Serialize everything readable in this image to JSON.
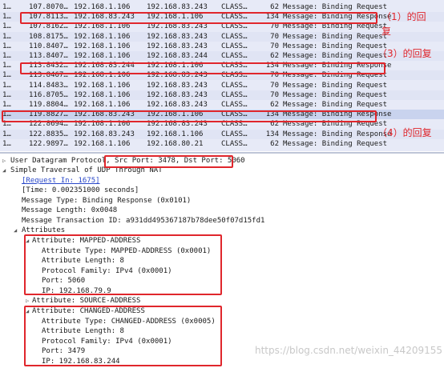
{
  "packets": [
    {
      "no": "1…",
      "time": "107.8070…",
      "src": "192.168.1.106",
      "dst": "192.168.83.243",
      "proto": "CLASS…",
      "len": "62",
      "info": "Message: Binding Request"
    },
    {
      "no": "1…",
      "time": "107.8113…",
      "src": "192.168.83.243",
      "dst": "192.168.1.106",
      "proto": "CLASS…",
      "len": "134",
      "info": "Message: Binding Response"
    },
    {
      "no": "1…",
      "time": "107.8162…",
      "src": "192.168.1.106",
      "dst": "192.168.83.243",
      "proto": "CLASS…",
      "len": "70",
      "info": "Message: Binding Request"
    },
    {
      "no": "1…",
      "time": "108.8175…",
      "src": "192.168.1.106",
      "dst": "192.168.83.243",
      "proto": "CLASS…",
      "len": "70",
      "info": "Message: Binding Request"
    },
    {
      "no": "1…",
      "time": "110.8407…",
      "src": "192.168.1.106",
      "dst": "192.168.83.243",
      "proto": "CLASS…",
      "len": "70",
      "info": "Message: Binding Request"
    },
    {
      "no": "1…",
      "time": "113.8407…",
      "src": "192.168.1.106",
      "dst": "192.168.83.244",
      "proto": "CLASS…",
      "len": "62",
      "info": "Message: Binding Request"
    },
    {
      "no": "1…",
      "time": "113.8432…",
      "src": "192.168.83.244",
      "dst": "192.168.1.106",
      "proto": "CLASS…",
      "len": "134",
      "info": "Message: Binding Response"
    },
    {
      "no": "1…",
      "time": "113.8467…",
      "src": "192.168.1.106",
      "dst": "192.168.83.243",
      "proto": "CLASS…",
      "len": "70",
      "info": "Message: Binding Request"
    },
    {
      "no": "1…",
      "time": "114.8483…",
      "src": "192.168.1.106",
      "dst": "192.168.83.243",
      "proto": "CLASS…",
      "len": "70",
      "info": "Message: Binding Request"
    },
    {
      "no": "1…",
      "time": "116.8705…",
      "src": "192.168.1.106",
      "dst": "192.168.83.243",
      "proto": "CLASS…",
      "len": "70",
      "info": "Message: Binding Request"
    },
    {
      "no": "1…",
      "time": "119.8804…",
      "src": "192.168.1.106",
      "dst": "192.168.83.243",
      "proto": "CLASS…",
      "len": "62",
      "info": "Message: Binding Request"
    },
    {
      "no": "1…",
      "time": "119.8827…",
      "src": "192.168.83.243",
      "dst": "192.168.1.106",
      "proto": "CLASS…",
      "len": "134",
      "info": "Message: Binding Response"
    },
    {
      "no": "1…",
      "time": "122.8694…",
      "src": "192.168.1.106",
      "dst": "192.168.83.243",
      "proto": "CLASS…",
      "len": "62",
      "info": "Message: Binding Request"
    },
    {
      "no": "1…",
      "time": "122.8835…",
      "src": "192.168.83.243",
      "dst": "192.168.1.106",
      "proto": "CLASS…",
      "len": "134",
      "info": "Message: Binding Response"
    },
    {
      "no": "1…",
      "time": "122.9897…",
      "src": "192.168.1.106",
      "dst": "192.168.80.21",
      "proto": "CLASS…",
      "len": "62",
      "info": "Message: Binding Request"
    }
  ],
  "details": {
    "udp_prefix": "User Datagram Protocol, ",
    "udp_ports": "Src Port: 3478, Dst Port: 5060",
    "stun_title": "Simple Traversal of UDP Through NAT",
    "request_in": "[Request In: 1675]",
    "time": "[Time: 0.002351000 seconds]",
    "msg_type": "Message Type: Binding Response (0x0101)",
    "msg_len": "Message Length: 0x0048",
    "txn_id": "Message Transaction ID: a931dd495367187b78dee50f07d15fd1",
    "attributes": "Attributes",
    "mapped": {
      "title": "Attribute: MAPPED-ADDRESS",
      "type": "Attribute Type: MAPPED-ADDRESS (0x0001)",
      "length": "Attribute Length: 8",
      "family": "Protocol Family: IPv4 (0x0001)",
      "port": "Port: 5060",
      "ip": "IP: 192.168.79.9"
    },
    "source": {
      "title": "Attribute: SOURCE-ADDRESS"
    },
    "changed": {
      "title": "Attribute: CHANGED-ADDRESS",
      "type": "Attribute Type: CHANGED-ADDRESS (0x0005)",
      "length": "Attribute Length: 8",
      "family": "Protocol Family: IPv4 (0x0001)",
      "port": "Port: 3479",
      "ip": "IP: 192.168.83.244"
    }
  },
  "annotations": {
    "reply1": "（1）的回",
    "reply1b": "复",
    "reply3": "（3）的回复",
    "reply4": "（4）的回复"
  },
  "watermark": "https://blog.csdn.net/weixin_44209155",
  "colors": {
    "annotation": "#e0262c",
    "packet_bg": "#e7eaf7",
    "link": "#2a48c9"
  }
}
